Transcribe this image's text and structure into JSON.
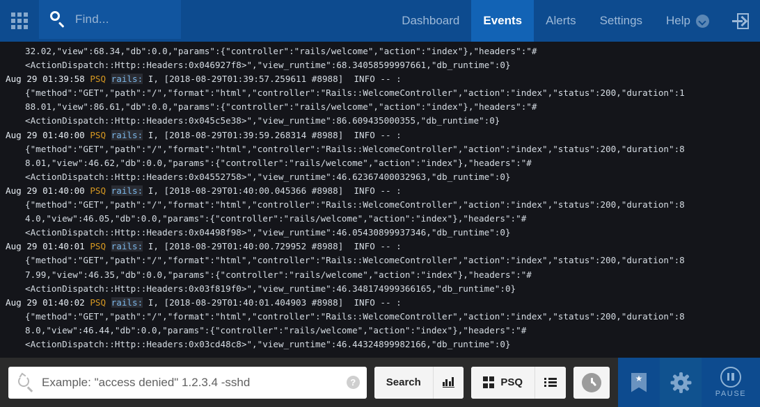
{
  "header": {
    "launcher_icon": "app-grid-icon",
    "find": {
      "icon": "search-icon",
      "placeholder": "Find..."
    },
    "nav": [
      {
        "label": "Dashboard",
        "active": false
      },
      {
        "label": "Events",
        "active": true
      },
      {
        "label": "Alerts",
        "active": false
      },
      {
        "label": "Settings",
        "active": false
      },
      {
        "label": "Help",
        "active": false,
        "has_dropdown": true
      }
    ],
    "logout_icon": "sign-in-arrow-icon",
    "colors": {
      "header_bg": "#0d4b8f",
      "active_tab_bg": "#1263b5",
      "find_bg": "#11559f",
      "nav_text": "#9db9d8"
    }
  },
  "log": {
    "lines": [
      {
        "type": "cont",
        "text": "32.02,\"view\":68.34,\"db\":0.0,\"params\":{\"controller\":\"rails/welcome\",\"action\":\"index\"},\"headers\":\"#"
      },
      {
        "type": "cont",
        "text": "<ActionDispatch::Http::Headers:0x046927f8>\",\"view_runtime\":68.34058599997661,\"db_runtime\":0}"
      },
      {
        "type": "head",
        "timestamp": "Aug 29 01:39:58",
        "host": "PSQ",
        "program": "rails:",
        "rest": " I, [2018-08-29T01:39:57.259611 #8988]  INFO -- :"
      },
      {
        "type": "cont",
        "text": "{\"method\":\"GET\",\"path\":\"/\",\"format\":\"html\",\"controller\":\"Rails::WelcomeController\",\"action\":\"index\",\"status\":200,\"duration\":1"
      },
      {
        "type": "cont",
        "text": "88.01,\"view\":86.61,\"db\":0.0,\"params\":{\"controller\":\"rails/welcome\",\"action\":\"index\"},\"headers\":\"#"
      },
      {
        "type": "cont",
        "text": "<ActionDispatch::Http::Headers:0x045c5e38>\",\"view_runtime\":86.609435000355,\"db_runtime\":0}"
      },
      {
        "type": "head",
        "timestamp": "Aug 29 01:40:00",
        "host": "PSQ",
        "program": "rails:",
        "rest": " I, [2018-08-29T01:39:59.268314 #8988]  INFO -- :"
      },
      {
        "type": "cont",
        "text": "{\"method\":\"GET\",\"path\":\"/\",\"format\":\"html\",\"controller\":\"Rails::WelcomeController\",\"action\":\"index\",\"status\":200,\"duration\":8"
      },
      {
        "type": "cont",
        "text": "8.01,\"view\":46.62,\"db\":0.0,\"params\":{\"controller\":\"rails/welcome\",\"action\":\"index\"},\"headers\":\"#"
      },
      {
        "type": "cont",
        "text": "<ActionDispatch::Http::Headers:0x04552758>\",\"view_runtime\":46.62367400032963,\"db_runtime\":0}"
      },
      {
        "type": "head",
        "timestamp": "Aug 29 01:40:00",
        "host": "PSQ",
        "program": "rails:",
        "rest": " I, [2018-08-29T01:40:00.045366 #8988]  INFO -- :"
      },
      {
        "type": "cont",
        "text": "{\"method\":\"GET\",\"path\":\"/\",\"format\":\"html\",\"controller\":\"Rails::WelcomeController\",\"action\":\"index\",\"status\":200,\"duration\":8"
      },
      {
        "type": "cont",
        "text": "4.0,\"view\":46.05,\"db\":0.0,\"params\":{\"controller\":\"rails/welcome\",\"action\":\"index\"},\"headers\":\"#"
      },
      {
        "type": "cont",
        "text": "<ActionDispatch::Http::Headers:0x04498f98>\",\"view_runtime\":46.05430899937346,\"db_runtime\":0}"
      },
      {
        "type": "head",
        "timestamp": "Aug 29 01:40:01",
        "host": "PSQ",
        "program": "rails:",
        "rest": " I, [2018-08-29T01:40:00.729952 #8988]  INFO -- :"
      },
      {
        "type": "cont",
        "text": "{\"method\":\"GET\",\"path\":\"/\",\"format\":\"html\",\"controller\":\"Rails::WelcomeController\",\"action\":\"index\",\"status\":200,\"duration\":8"
      },
      {
        "type": "cont",
        "text": "7.99,\"view\":46.35,\"db\":0.0,\"params\":{\"controller\":\"rails/welcome\",\"action\":\"index\"},\"headers\":\"#"
      },
      {
        "type": "cont",
        "text": "<ActionDispatch::Http::Headers:0x03f819f0>\",\"view_runtime\":46.348174999366165,\"db_runtime\":0}"
      },
      {
        "type": "head",
        "timestamp": "Aug 29 01:40:02",
        "host": "PSQ",
        "program": "rails:",
        "rest": " I, [2018-08-29T01:40:01.404903 #8988]  INFO -- :"
      },
      {
        "type": "cont",
        "text": "{\"method\":\"GET\",\"path\":\"/\",\"format\":\"html\",\"controller\":\"Rails::WelcomeController\",\"action\":\"index\",\"status\":200,\"duration\":8"
      },
      {
        "type": "cont",
        "text": "8.0,\"view\":46.44,\"db\":0.0,\"params\":{\"controller\":\"rails/welcome\",\"action\":\"index\"},\"headers\":\"#"
      },
      {
        "type": "cont",
        "text": "<ActionDispatch::Http::Headers:0x03cd48c8>\",\"view_runtime\":46.44324899982166,\"db_runtime\":0}"
      }
    ],
    "colors": {
      "background": "#14151a",
      "text": "#d6dde4",
      "host": "#d79921",
      "program": "#7cb7e8",
      "program_bg": "#2a2c33"
    }
  },
  "bottom_bar": {
    "search": {
      "icon": "refresh-search-icon",
      "value": "",
      "placeholder": "Example: \"access denied\" 1.2.3.4 -sshd",
      "help_icon": "help-circle-icon",
      "help_label": "?"
    },
    "search_button_label": "Search",
    "chart_button_icon": "bar-chart-icon",
    "source_button_label": "PSQ",
    "source_button_icon": "squares-grid-icon",
    "list_button_icon": "list-view-icon",
    "clock_button_icon": "clock-icon",
    "bookmark_button_icon": "bookmark-star-icon",
    "settings_button_icon": "gear-icon",
    "pause": {
      "icon": "pause-circle-icon",
      "label": "PAUSE"
    },
    "colors": {
      "bar_bg": "#2b2b2b",
      "button_bg": "#f4f4f4",
      "action_bg": "#0d4b8f"
    }
  }
}
